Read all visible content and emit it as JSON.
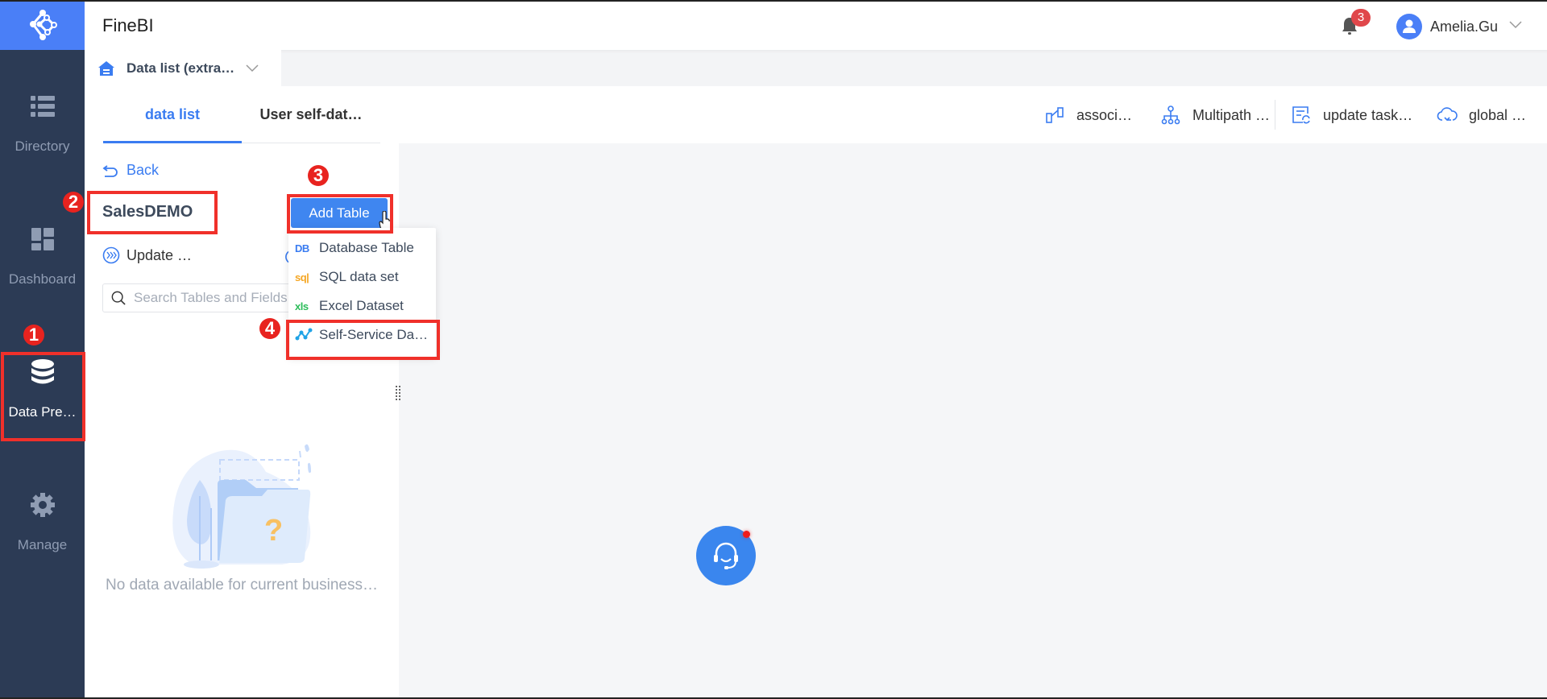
{
  "app": {
    "title": "FineBI"
  },
  "header": {
    "notifications_count": "3",
    "user_name": "Amelia.Gu"
  },
  "sidebar": {
    "items": [
      {
        "label": "Directory",
        "icon": "list-icon",
        "active": false
      },
      {
        "label": "Dashboard",
        "icon": "dashboard-grid-icon",
        "active": false
      },
      {
        "label": "Data Pre…",
        "icon": "database-icon",
        "active": true
      },
      {
        "label": "Manage",
        "icon": "gear-icon",
        "active": false
      }
    ]
  },
  "breadcrumb": {
    "label": "Data list (extra…",
    "icon": "home-icon"
  },
  "tabs": [
    {
      "label": "data list",
      "active": true
    },
    {
      "label": "User self-dat…",
      "active": false
    }
  ],
  "toolbar": {
    "items": [
      {
        "label": "associ…",
        "icon": "association-icon"
      },
      {
        "label": "Multipath …",
        "icon": "hierarchy-icon"
      },
      {
        "label": "update task…",
        "icon": "update-task-icon"
      },
      {
        "label": "global …",
        "icon": "cloud-refresh-icon"
      }
    ]
  },
  "left_panel": {
    "back_label": "Back",
    "package_title": "SalesDEMO",
    "add_table_label": "Add Table",
    "update_label": "Update …",
    "search": {
      "placeholder": "Search Tables and Fields",
      "value": ""
    },
    "empty_text": "No data available for current business…"
  },
  "add_table_menu": {
    "items": [
      {
        "label": "Database Table",
        "icon_text": "DB",
        "color": "#3a7cf1"
      },
      {
        "label": "SQL data set",
        "icon_text": "sq|",
        "color": "#f5a623"
      },
      {
        "label": "Excel Dataset",
        "icon_text": "xls",
        "color": "#2dbd5a"
      },
      {
        "label": "Self-Service Da…",
        "icon_text": "",
        "color": "#1fa3e6"
      }
    ]
  },
  "annotations": [
    "1",
    "2",
    "3",
    "4"
  ],
  "colors": {
    "brand": "#4a7ff7",
    "sidebar_bg": "#2c3b55",
    "primary_button": "#3f86f0",
    "annotation_red": "#f0302a",
    "badge_red": "#e0474b"
  }
}
